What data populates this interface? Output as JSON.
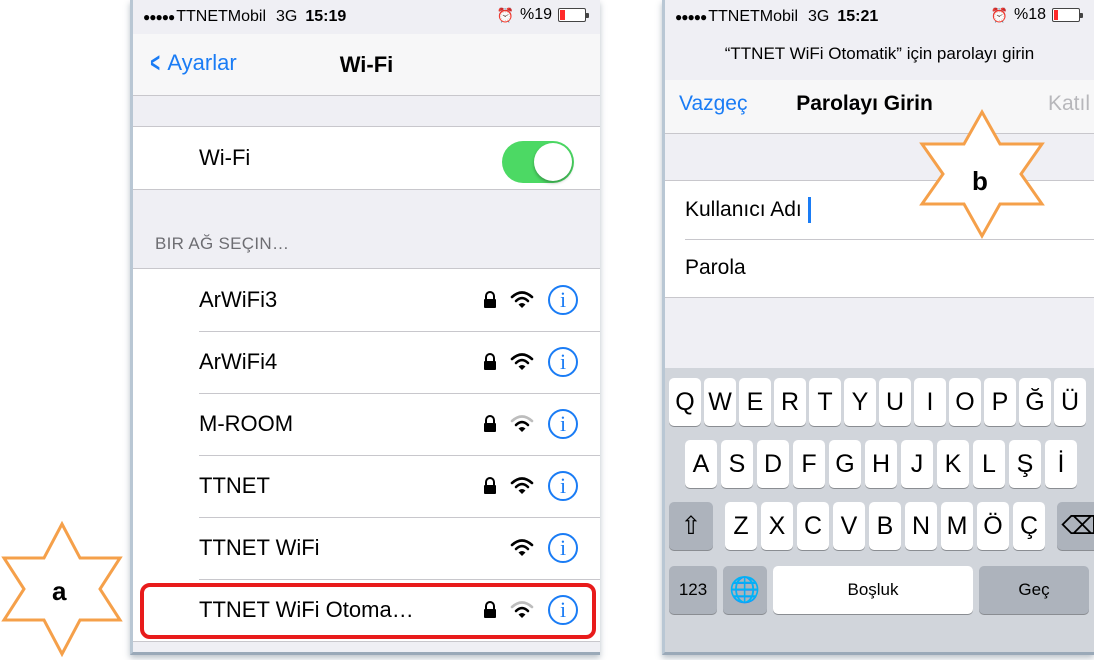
{
  "left_phone": {
    "status": {
      "signal_dots": "●●●●●",
      "carrier": "TTNETMobil",
      "network": "3G",
      "time": "15:19",
      "battery_text": "%19",
      "battery_level": 0.19
    },
    "nav": {
      "back_label": "Ayarlar",
      "title": "Wi-Fi"
    },
    "wifi_toggle": {
      "label": "Wi-Fi",
      "on": true
    },
    "section_header": "BIR AĞ SEÇIN…",
    "networks": [
      {
        "name": "ArWiFi3",
        "locked": true,
        "signal": "full"
      },
      {
        "name": "ArWiFi4",
        "locked": true,
        "signal": "full"
      },
      {
        "name": "M-ROOM",
        "locked": true,
        "signal": "medium"
      },
      {
        "name": "TTNET",
        "locked": true,
        "signal": "full"
      },
      {
        "name": "TTNET WiFi",
        "locked": false,
        "signal": "full"
      },
      {
        "name": "TTNET WiFi Otoma…",
        "locked": true,
        "signal": "medium"
      }
    ],
    "info_glyph": "i"
  },
  "right_phone": {
    "status": {
      "signal_dots": "●●●●●",
      "carrier": "TTNETMobil",
      "network": "3G",
      "time": "15:21",
      "battery_text": "%18",
      "battery_level": 0.18
    },
    "prompt": "“TTNET WiFi Otomatik” için parolayı girin",
    "nav": {
      "cancel_label": "Vazgeç",
      "title": "Parolayı Girin",
      "join_label": "Katıl"
    },
    "form": {
      "username_label": "Kullanıcı Adı",
      "password_label": "Parola"
    },
    "keyboard": {
      "row1": [
        "Q",
        "W",
        "E",
        "R",
        "T",
        "Y",
        "U",
        "I",
        "O",
        "P",
        "Ğ",
        "Ü"
      ],
      "row2": [
        "A",
        "S",
        "D",
        "F",
        "G",
        "H",
        "J",
        "K",
        "L",
        "Ş",
        "İ"
      ],
      "row3": [
        "Z",
        "X",
        "C",
        "V",
        "B",
        "N",
        "M",
        "Ö",
        "Ç"
      ],
      "shift_glyph": "⇧",
      "backspace_glyph": "⌫",
      "numbers_label": "123",
      "globe_glyph": "🌐",
      "space_label": "Boşluk",
      "return_label": "Geç"
    }
  },
  "annotations": {
    "star_a_label": "a",
    "star_b_label": "b",
    "star_color": "#f5a04a",
    "highlight_color": "#e81b1b"
  },
  "colors": {
    "ios_blue": "#1a7cf5",
    "toggle_green": "#4cd964"
  }
}
